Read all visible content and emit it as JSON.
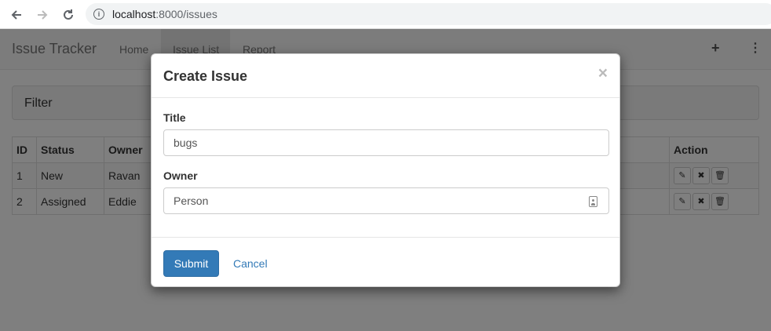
{
  "browser": {
    "host": "localhost",
    "path": ":8000/issues"
  },
  "navbar": {
    "brand": "Issue Tracker",
    "links": [
      "Home",
      "Issue List",
      "Report"
    ],
    "active": "Issue List"
  },
  "filter": {
    "title": "Filter"
  },
  "table": {
    "headers": [
      "ID",
      "Status",
      "Owner",
      "Action"
    ],
    "rows": [
      {
        "id": "1",
        "status": "New",
        "owner": "Ravan"
      },
      {
        "id": "2",
        "status": "Assigned",
        "owner": "Eddie"
      }
    ]
  },
  "modal": {
    "title": "Create Issue",
    "close": "×",
    "title_label": "Title",
    "title_value": "bugs",
    "owner_label": "Owner",
    "owner_value": "Person",
    "submit_label": "Submit",
    "cancel_label": "Cancel"
  },
  "colors": {
    "primary": "#337ab7",
    "backdrop": "rgba(0,0,0,0.5)"
  }
}
